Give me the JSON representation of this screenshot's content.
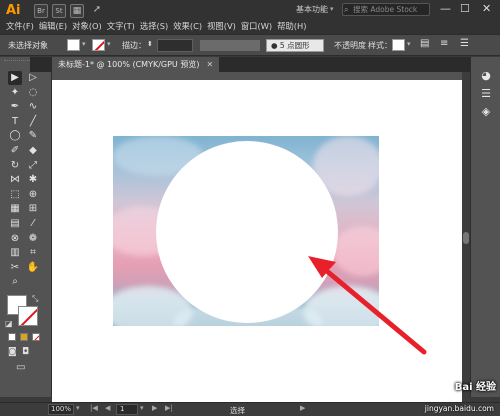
{
  "app": {
    "logo": "Ai",
    "btn_br": "Br",
    "btn_st": "St"
  },
  "menu": [
    "文件(F)",
    "编辑(E)",
    "对象(O)",
    "文字(T)",
    "选择(S)",
    "效果(C)",
    "视图(V)",
    "窗口(W)",
    "帮助(H)"
  ],
  "workspace": {
    "label": "基本功能",
    "caret": "▾"
  },
  "search": {
    "placeholder": "搜索 Adobe Stock"
  },
  "window_controls": {
    "minimize": "—",
    "maximize": "☐",
    "close": "✕"
  },
  "control_bar": {
    "selection": "未选择对象",
    "stroke_label": "描边：",
    "stroke_unit": "⬍",
    "brush": "● 5 点圆形",
    "opacity": "不透明度",
    "style": "样式："
  },
  "tab": {
    "title": "未标题-1* @ 100% (CMYK/GPU 预览)",
    "close": "✕"
  },
  "tools": [
    {
      "icon": "selection-tool-icon",
      "glyph": "▶"
    },
    {
      "icon": "direct-selection-tool-icon",
      "glyph": "▷"
    },
    {
      "icon": "magic-wand-icon",
      "glyph": "✦"
    },
    {
      "icon": "lasso-icon",
      "glyph": "◌"
    },
    {
      "icon": "pen-tool-icon",
      "glyph": "✒"
    },
    {
      "icon": "curvature-tool-icon",
      "glyph": "∿"
    },
    {
      "icon": "type-tool-icon",
      "glyph": "T"
    },
    {
      "icon": "line-tool-icon",
      "glyph": "╱"
    },
    {
      "icon": "ellipse-tool-icon",
      "glyph": "◯"
    },
    {
      "icon": "paintbrush-icon",
      "glyph": "✎"
    },
    {
      "icon": "shaper-tool-icon",
      "glyph": "✐"
    },
    {
      "icon": "eraser-icon",
      "glyph": "◆"
    },
    {
      "icon": "rotate-tool-icon",
      "glyph": "↻"
    },
    {
      "icon": "scale-tool-icon",
      "glyph": "⤢"
    },
    {
      "icon": "width-tool-icon",
      "glyph": "⋈"
    },
    {
      "icon": "puppet-warp-icon",
      "glyph": "✱"
    },
    {
      "icon": "free-transform-icon",
      "glyph": "⬚"
    },
    {
      "icon": "shape-builder-icon",
      "glyph": "⊕"
    },
    {
      "icon": "perspective-grid-icon",
      "glyph": "▦"
    },
    {
      "icon": "mesh-tool-icon",
      "glyph": "⊞"
    },
    {
      "icon": "gradient-tool-icon",
      "glyph": "▤"
    },
    {
      "icon": "eyedropper-icon",
      "glyph": "⁄"
    },
    {
      "icon": "blend-tool-icon",
      "glyph": "⊗"
    },
    {
      "icon": "symbol-sprayer-icon",
      "glyph": "❁"
    },
    {
      "icon": "column-graph-icon",
      "glyph": "▥"
    },
    {
      "icon": "artboard-tool-icon",
      "glyph": "⌗"
    },
    {
      "icon": "slice-tool-icon",
      "glyph": "✂"
    },
    {
      "icon": "hand-tool-icon",
      "glyph": "✋"
    },
    {
      "icon": "zoom-tool-icon",
      "glyph": "⌕"
    }
  ],
  "panels": [
    {
      "icon": "color-panel-icon",
      "glyph": "◕"
    },
    {
      "icon": "properties-panel-icon",
      "glyph": "☰"
    },
    {
      "icon": "layers-panel-icon",
      "glyph": "◈"
    }
  ],
  "status": {
    "zoom": "100%",
    "page": "1",
    "tool": "选择",
    "nav_first": "|◀",
    "nav_prev": "◀",
    "nav_next": "▶",
    "nav_last": "▶|",
    "dropdown": "▾"
  },
  "watermark": {
    "brand": "Bai 经验",
    "url": "jingyan.baidu.com"
  },
  "colors": {
    "arrow": "#e8202a",
    "accent": "#ff9a00"
  }
}
